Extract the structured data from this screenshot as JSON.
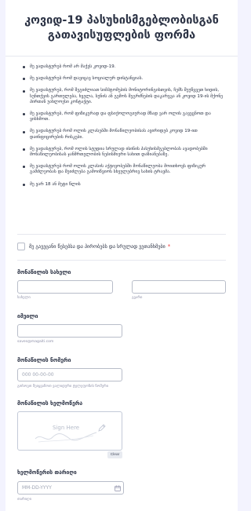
{
  "header": {
    "title_line1": "კოვიდ-19 პასუხისმგებლობისგან",
    "title_line2": "გათავისუფლების ფორმა"
  },
  "rules": [
    "მე ვადასტურებ რომ არ მაქვს კოვიდ-19.",
    "მე ვადასტურებ რომ დავიცავ სოციალურ დისტანციას.",
    "მე ვადასტურებ, რომ შეგიძლიათ სიმპტომების მონიტორინგისთვის, ჩემს შეუწყვეთ ხიდის, სუნთქვის გართულება, ხველა, სუნის ან გემოს შეგრძნების დაკარგვა ან კოვიდ 19-ის მქონე პირთან უახლოესი კონტაქტი.",
    "მე ვადასტურებ, რომ ფიზიკურად და ფსიქოლოგიურად მზად ვარ ოლის გავეცნოთ და ვისხმოთ.",
    "მე ვადასტურებ რომ ოლის კლასებში მონაწილეობისას ავირიდებ კოვიდ 19-ით დაინფიცირების რისკები.",
    "მე ვადასტურებ, რომ ოლის სტუდია სრულად ისინის პასუხისმგებლობას ავადობებში მონაწილეობისას ჯანმრთელობის ნებისმიერი სახით დაზიანებაზე.",
    "მე ვადასტურებ რომ ოლის კლასის აქტივობებში მონაწილეობა მოითხოვს ფიზიკურ გამძლეობას და შეიძლება გამოიწვიოს სხეულებრივ სახის ტრავმა.",
    "მე ვარ 18 ან მეტი წლის"
  ],
  "agreement": {
    "label": "მე გავეცანი წესებსა და პირობებს და სრულად ვეთანხმები",
    "required_mark": "*"
  },
  "name": {
    "label": "მონაწილის სახელი",
    "first_sublabel": "სახელი",
    "last_sublabel": "გვარი"
  },
  "email": {
    "label": "იმეილი",
    "sublabel": "saves@magaiti.com"
  },
  "phone": {
    "label": "მონაწილის ნომერი",
    "placeholder": "000 00-00-00",
    "sublabel": "გთხოვთ შეიყვანოთ ვალიდური ტელეფონის ნომერი"
  },
  "signature": {
    "label": "მონაწილის ხელმოწერა",
    "placeholder_text": "Sign Here",
    "clear_label": "Clear"
  },
  "date": {
    "label": "ხელმოწერის თარიღი",
    "placeholder": "MM-DD-YYYY",
    "sublabel": "თარიღი"
  },
  "colors": {
    "background": "#f3f3fe",
    "card": "#ffffff",
    "required": "#f23a3c",
    "border": "#b8bdc9"
  },
  "icons": {
    "date_picker": "calendar-icon",
    "signature_pen": "pen-icon"
  }
}
